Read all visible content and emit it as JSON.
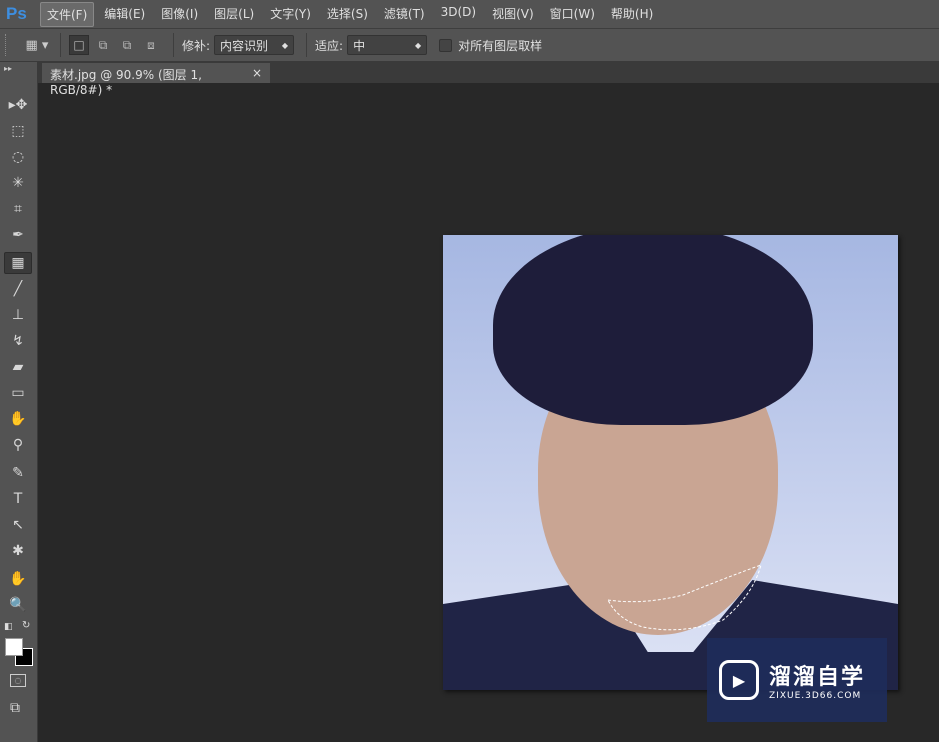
{
  "app": {
    "logo": "Ps"
  },
  "menu": [
    "文件(F)",
    "编辑(E)",
    "图像(I)",
    "图层(L)",
    "文字(Y)",
    "选择(S)",
    "滤镜(T)",
    "3D(D)",
    "视图(V)",
    "窗口(W)",
    "帮助(H)"
  ],
  "options": {
    "patch_label": "修补:",
    "patch_value": "内容识别",
    "adapt_label": "适应:",
    "adapt_value": "中",
    "sample_all_label": "对所有图层取样",
    "sample_all_checked": false
  },
  "document": {
    "tab_title": "素材.jpg @ 90.9% (图层 1, RGB/8#) *",
    "close": "×"
  },
  "tools": [
    {
      "name": "move",
      "glyph": "▸✥"
    },
    {
      "name": "marquee",
      "glyph": "⬚"
    },
    {
      "name": "lasso",
      "glyph": "◌"
    },
    {
      "name": "magic-wand",
      "glyph": "✳"
    },
    {
      "name": "crop",
      "glyph": "⌗"
    },
    {
      "name": "eyedropper",
      "glyph": "✒"
    },
    {
      "name": "patch",
      "glyph": "▦",
      "selected": true
    },
    {
      "name": "brush",
      "glyph": "╱"
    },
    {
      "name": "clone-stamp",
      "glyph": "⊥"
    },
    {
      "name": "history-brush",
      "glyph": "↯"
    },
    {
      "name": "eraser",
      "glyph": "▰"
    },
    {
      "name": "gradient",
      "glyph": "▭"
    },
    {
      "name": "blur",
      "glyph": "✋"
    },
    {
      "name": "dodge",
      "glyph": "⚲"
    },
    {
      "name": "pen",
      "glyph": "✎"
    },
    {
      "name": "type",
      "glyph": "T"
    },
    {
      "name": "path-selection",
      "glyph": "↖"
    },
    {
      "name": "custom-shape",
      "glyph": "✱"
    },
    {
      "name": "hand",
      "glyph": "✋"
    },
    {
      "name": "zoom",
      "glyph": "🔍"
    }
  ],
  "watermark": {
    "title": "溜溜自学",
    "url": "ZIXUE.3D66.COM"
  }
}
